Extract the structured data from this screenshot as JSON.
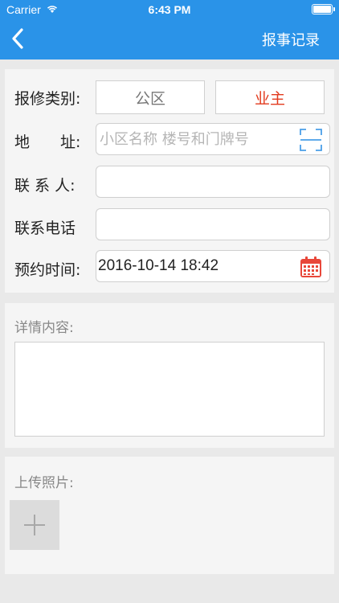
{
  "status_bar": {
    "carrier": "Carrier",
    "time": "6:43 PM"
  },
  "header": {
    "title": "报事记录",
    "back_icon": "chevron-left-icon",
    "background": "#2a93e8"
  },
  "form": {
    "category": {
      "label": "报修类别:",
      "options": [
        "公区",
        "业主"
      ],
      "selected": "业主",
      "selected_color": "#e23b1e"
    },
    "address": {
      "label": "地　　址:",
      "placeholder": "小区名称 楼号和门牌号",
      "icon": "scan-icon"
    },
    "contact": {
      "label": "联 系 人:",
      "value": ""
    },
    "phone": {
      "label": "联系电话",
      "value": ""
    },
    "appointment": {
      "label": "预约时间:",
      "value": "2016-10-14 18:42",
      "icon": "calendar-icon"
    }
  },
  "details": {
    "label": "详情内容:",
    "value": ""
  },
  "upload": {
    "label": "上传照片:",
    "add_icon": "plus-icon"
  }
}
